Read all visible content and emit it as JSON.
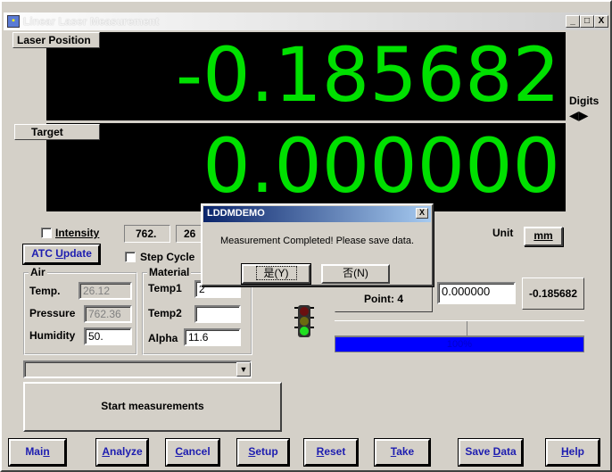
{
  "window": {
    "title": "Linear Laser Measurement",
    "minimize": "_",
    "maximize": "□",
    "close": "X"
  },
  "laser_position": {
    "label": "Laser Position",
    "value": "-0.185682"
  },
  "target": {
    "label": "Target",
    "value": "0.000000"
  },
  "digits": {
    "label": "Digits",
    "left_arrow": "◀",
    "right_arrow": "▶"
  },
  "intensity": {
    "label": "Intensity",
    "value1": "762.",
    "value2": "26"
  },
  "atc_update": {
    "label_pre": "ATC ",
    "label_u": "U",
    "label_post": "pdate"
  },
  "step_cycle": {
    "label": "Step Cycle"
  },
  "unit": {
    "label": "Unit",
    "value": "mm"
  },
  "air": {
    "title": "Air",
    "temp_label": "Temp.",
    "temp_value": "26.12",
    "pressure_label": "Pressure",
    "pressure_value": "762.36",
    "humidity_label": "Humidity",
    "humidity_value": "50."
  },
  "material": {
    "title": "Material",
    "temp1_label": "Temp1",
    "temp1_value": "2",
    "temp2_label": "Temp2",
    "temp2_value": "",
    "alpha_label": "Alpha",
    "alpha_value": "11.6"
  },
  "point": {
    "label": "Point: 4"
  },
  "target_field_value": "0.000000",
  "laser_readout": "-0.185682",
  "progress": {
    "percent": 100,
    "label": "100%",
    "color": "#0000ff"
  },
  "combo": {
    "value": ""
  },
  "start_button": "Start measurements",
  "bottom_buttons": [
    {
      "pre": "Mai",
      "u": "n",
      "post": "",
      "name": "main-button"
    },
    {
      "pre": "",
      "u": "A",
      "post": "nalyze",
      "name": "analyze-button"
    },
    {
      "pre": "",
      "u": "C",
      "post": "ancel",
      "name": "cancel-button"
    },
    {
      "pre": "",
      "u": "S",
      "post": "etup",
      "name": "setup-button"
    },
    {
      "pre": "",
      "u": "R",
      "post": "eset",
      "name": "reset-button"
    },
    {
      "pre": "",
      "u": "T",
      "post": "ake",
      "name": "take-button"
    },
    {
      "pre": "Save ",
      "u": "D",
      "post": "ata",
      "name": "save-data-button"
    },
    {
      "pre": "",
      "u": "H",
      "post": "elp",
      "name": "help-button"
    }
  ],
  "dialog": {
    "title": "LDDMDEMO",
    "close": "X",
    "message": "Measurement Completed! Please save data.",
    "yes_label": "是(Y)",
    "no_label": "否(N)"
  },
  "colors": {
    "display_bg": "#000000",
    "display_fg": "#00e000",
    "face": "#d4d0c8",
    "button_text": "#1d1db0"
  }
}
